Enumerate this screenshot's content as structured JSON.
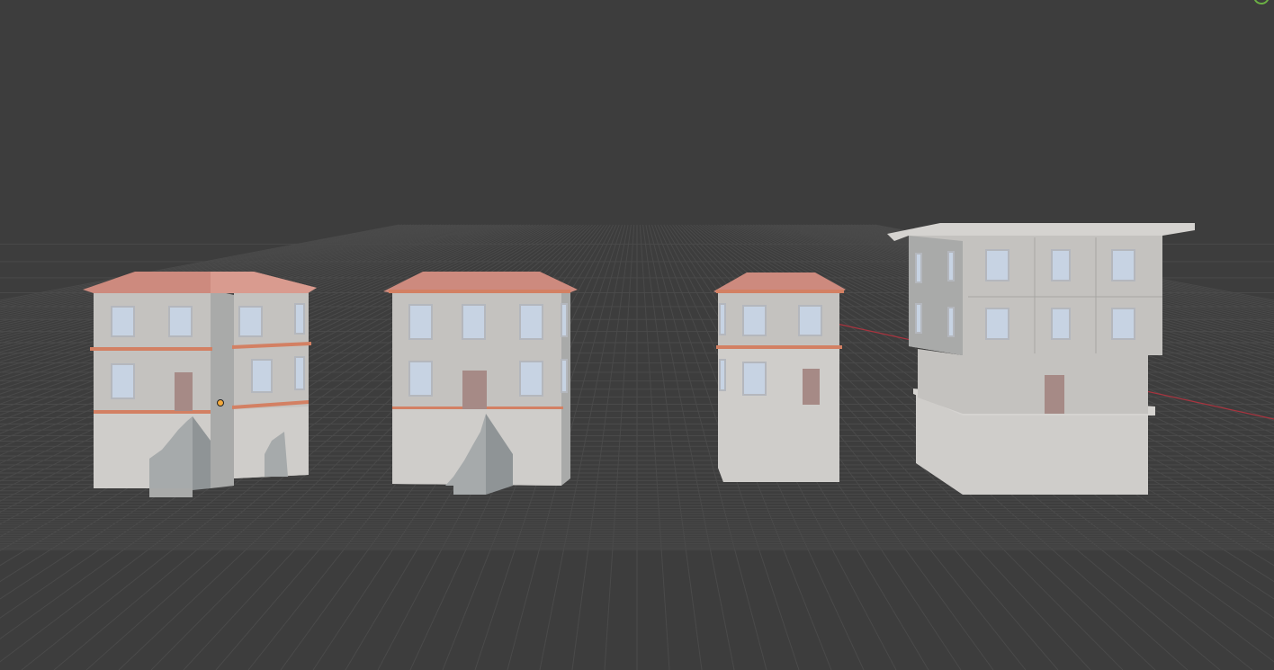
{
  "app": "3D viewport",
  "viewport": {
    "background": "#3d3d3d",
    "grid_color": "#4a4a4a",
    "x_axis_color": "#a8343f"
  },
  "scene": {
    "objects": [
      {
        "name": "house-l-shape-with-stairs",
        "roof": "hip-roof",
        "roof_color": "#cd8a7e",
        "wall_color": "#c4c2bf",
        "trim_color": "#d38063"
      },
      {
        "name": "house-box-with-stairs",
        "roof": "hip-roof",
        "roof_color": "#cd8a7e",
        "wall_color": "#c4c2bf",
        "trim_color": "#d38063"
      },
      {
        "name": "house-narrow",
        "roof": "hip-roof",
        "roof_color": "#cd8a7e",
        "wall_color": "#c4c2bf",
        "trim_color": "#d38063"
      },
      {
        "name": "house-flat-roof",
        "roof": "flat-roof",
        "roof_color": "#d5d3d0",
        "wall_color": "#c4c2bf",
        "trim_color": "#bdbbb8"
      }
    ],
    "window_color": "#c7d3e3",
    "window_frame_color": "#b4b7bd",
    "door_color": "#a68a86",
    "origin_marker_color": "#f3a93c"
  },
  "gizmo": {
    "icon": "navigation-gizmo-icon",
    "color": "#6bb044"
  }
}
